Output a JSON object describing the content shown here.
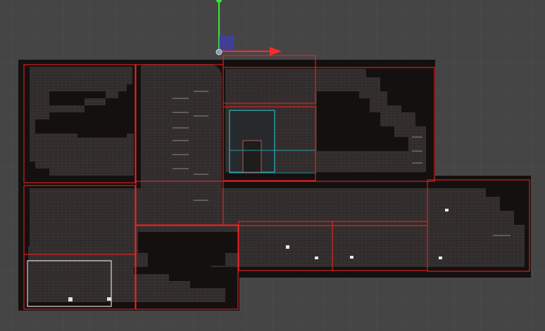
{
  "scene_view": {
    "background_color": "#454545",
    "grid_color": "#505050",
    "room_outline_color": "#ff2020",
    "selection_outline_color": "#ffffff",
    "level_fill_color": "#1a1616",
    "gizmo": {
      "x_axis_color": "#ff2a2a",
      "y_axis_color": "#39e639",
      "plane_handle_color": "#3a3ad6",
      "pivot_color": "#8aa0b0"
    }
  }
}
